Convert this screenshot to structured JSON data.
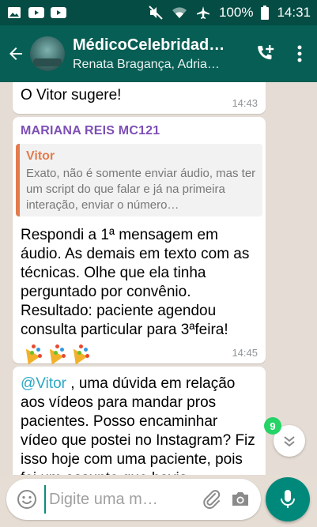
{
  "status_bar": {
    "battery": "100%",
    "time": "14:31"
  },
  "header": {
    "title": "MédicoCelebridad…",
    "subtitle": "Renata Bragança,  Adria…"
  },
  "messages": [
    {
      "text": "O Vitor sugere!",
      "time": "14:43"
    },
    {
      "sender": "MARIANA REIS MC121",
      "quote_author": "Vitor",
      "quote_text": "Exato, não é somente enviar áudio, mas ter um script do que falar e já na primeira interação, enviar o número…",
      "text": "Respondi a 1ª mensagem em áudio. As demais em texto com as técnicas. Olhe que ela tinha perguntado por convênio. Resultado: paciente agendou consulta particular para 3ªfeira!",
      "time": "14:45"
    },
    {
      "mention": "@Vitor",
      "text": " , uma dúvida em relação aos vídeos para mandar pros pacientes. Posso encaminhar vídeo que postei no Instagram? Fiz isso hoje com uma paciente, pois foi um assunto que havia"
    }
  ],
  "unread_count": "9",
  "input": {
    "placeholder": "Digite uma m…"
  },
  "colors": {
    "header": "#075e54",
    "status_bar": "#054d44",
    "sender": "#7d4fb5",
    "quote_accent": "#e47b4d",
    "mention": "#2ba8c6",
    "fab": "#00897b"
  },
  "icons": [
    "image-icon",
    "youtube-icon",
    "youtube-icon",
    "mute-icon",
    "wifi-icon",
    "airplane-icon",
    "battery-icon",
    "back-arrow-icon",
    "add-call-icon",
    "more-vert-icon",
    "chevron-down-double-icon",
    "emoji-icon",
    "attach-icon",
    "camera-icon",
    "mic-icon"
  ]
}
